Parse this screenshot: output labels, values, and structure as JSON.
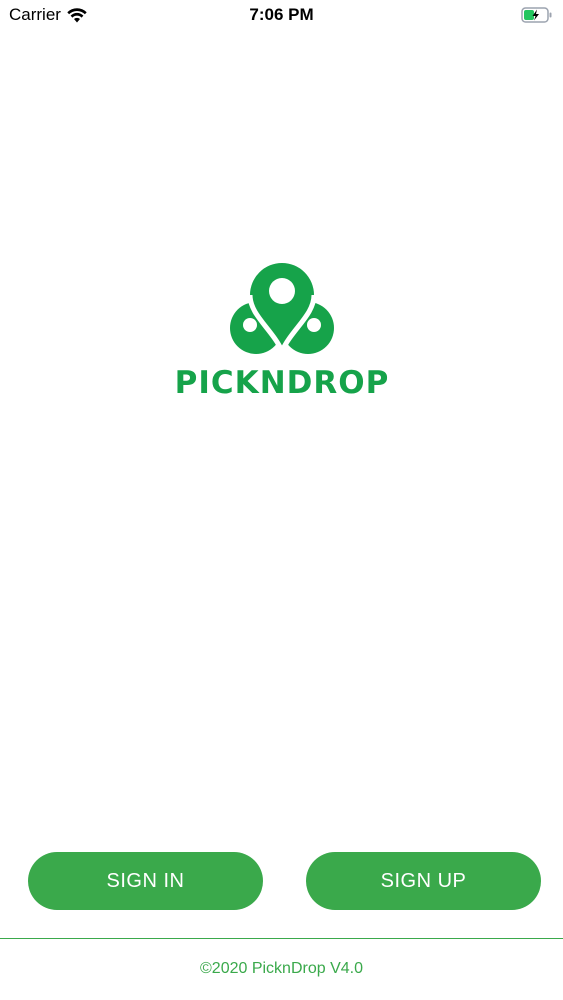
{
  "status_bar": {
    "carrier": "Carrier",
    "time": "7:06 PM",
    "wifi_icon": "wifi-icon",
    "battery_icon": "battery-charging-icon"
  },
  "brand": {
    "name": "PICKNDROP",
    "logo_icon": "location-pin-logo-icon",
    "color": "#16a34a"
  },
  "buttons": {
    "sign_in": "SIGN IN",
    "sign_up": "SIGN UP",
    "color": "#3aa94b"
  },
  "footer": {
    "text": "©2020 PicknDrop V4.0"
  }
}
